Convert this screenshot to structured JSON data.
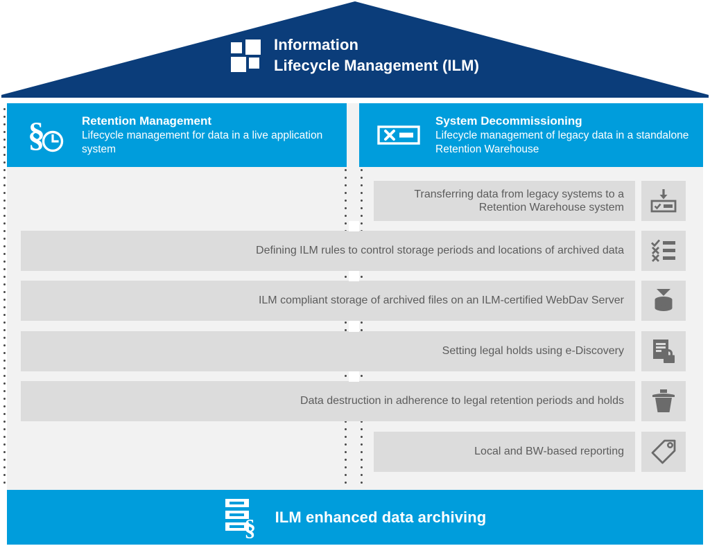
{
  "roof": {
    "logo_icon": "four-squares-logo-icon",
    "title_line1": "Information",
    "title_line2": "Lifecycle Management (ILM)",
    "color": "#0b3d7a"
  },
  "colors": {
    "dark_blue": "#0b3d7a",
    "accent_blue": "#009ddc",
    "panel_bg": "#f2f2f2",
    "row_bg": "#dcdcdc",
    "row_text": "#5c5c5c"
  },
  "columns": [
    {
      "id": "retention-management",
      "icon": "section-clock-icon",
      "title": "Retention Management",
      "subtitle": "Lifecycle management for data in a live application system"
    },
    {
      "id": "system-decommissioning",
      "icon": "decommission-box-icon",
      "title": "System Decommissioning",
      "subtitle": "Lifecycle management of legacy data in a standalone Retention Warehouse"
    }
  ],
  "rows": [
    {
      "id": "transferring-data",
      "label": "Transferring data from legacy systems to a Retention Warehouse system",
      "icon": "download-to-box-icon",
      "span": "right"
    },
    {
      "id": "defining-ilm-rules",
      "label": "Defining ILM rules to control storage periods and locations of archived data",
      "icon": "checklist-icon",
      "span": "both"
    },
    {
      "id": "ilm-compliant-storage",
      "label": "ILM compliant storage of archived files on an ILM-certified WebDav Server",
      "icon": "database-store-icon",
      "span": "both"
    },
    {
      "id": "legal-holds",
      "label": "Setting legal holds using  e-Discovery",
      "icon": "document-lock-icon",
      "span": "both"
    },
    {
      "id": "data-destruction",
      "label": "Data destruction in adherence to legal retention periods and holds",
      "icon": "trash-can-icon",
      "span": "both"
    },
    {
      "id": "reporting",
      "label": "Local and BW-based reporting",
      "icon": "tag-icon",
      "span": "right"
    }
  ],
  "footer": {
    "icon": "archive-rack-section-icon",
    "title": "ILM enhanced data archiving"
  }
}
